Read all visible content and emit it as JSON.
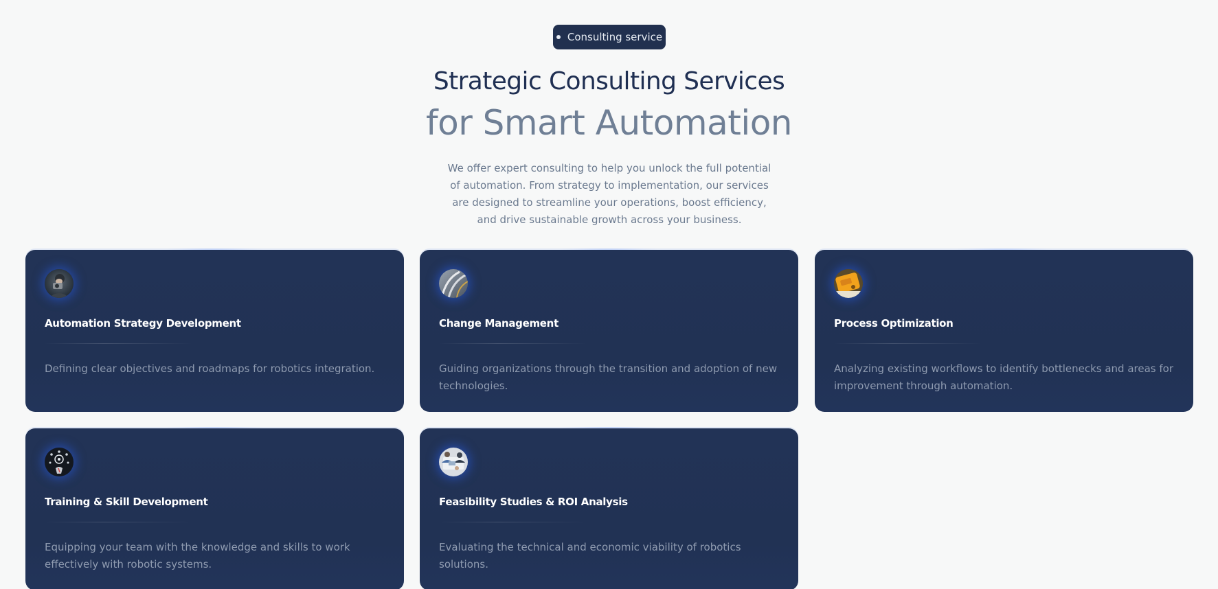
{
  "badge": {
    "label": "Consulting service"
  },
  "heading": {
    "line1": "Strategic Consulting Services",
    "line2": "for Smart Automation"
  },
  "intro": "We offer expert consulting to help you unlock the full potential of automation. From strategy to implementation, our services are designed to streamline your operations, boost efficiency, and drive sustainable growth across your business.",
  "colors": {
    "background": "#f7f8f8",
    "card": "#21304f",
    "heading_primary": "#1f2f52",
    "heading_secondary": "#6f7f95",
    "card_title": "#ffffff",
    "card_text": "#8f9bb0"
  },
  "services": [
    {
      "icon": "person-with-camera-icon",
      "title": "Automation Strategy Development",
      "description": "Defining clear objectives and roadmaps for robotics integration."
    },
    {
      "icon": "road-curves-icon",
      "title": "Change Management",
      "description": "Guiding organizations through the transition and adoption of new technologies."
    },
    {
      "icon": "yellow-device-icon",
      "title": "Process Optimization",
      "description": "Analyzing existing workflows to identify bottlenecks and areas for improvement through automation."
    },
    {
      "icon": "skills-network-icon",
      "title": "Training & Skill Development",
      "description": "Equipping your team with the knowledge and skills to work effectively with robotic systems."
    },
    {
      "icon": "team-meeting-icon",
      "title": "Feasibility Studies & ROI Analysis",
      "description": "Evaluating the technical and economic viability of robotics solutions."
    }
  ]
}
